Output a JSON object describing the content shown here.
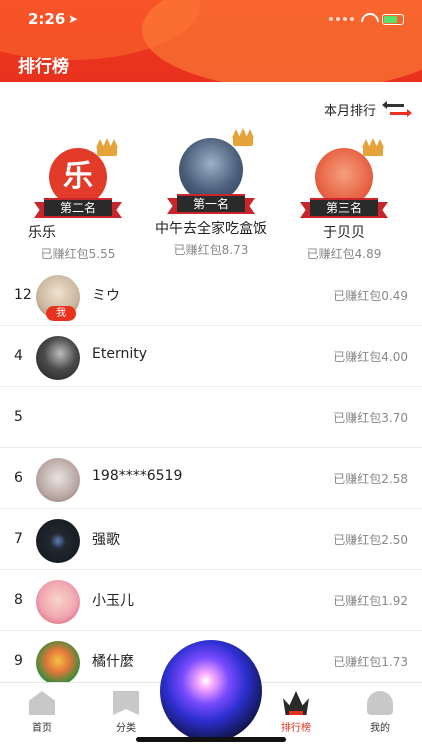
{
  "status": {
    "time": "2:26",
    "location_icon": "location-arrow-icon"
  },
  "header": {
    "title": "排行榜"
  },
  "month_switch": {
    "label": "本月排行",
    "icon": "swap-arrows-icon"
  },
  "podium": [
    {
      "rank_label": "第二名",
      "name": "乐乐",
      "earnings": "已赚红包5.55",
      "avatar_text": "乐",
      "avatar_color": "#e23b2a"
    },
    {
      "rank_label": "第一名",
      "name": "中午去全家吃盒饭",
      "earnings": "已赚红包8.73",
      "avatar_color": "#4b5e7a"
    },
    {
      "rank_label": "第三名",
      "name": "于贝贝",
      "earnings": "已赚红包4.89",
      "avatar_color": "#e45a3c"
    }
  ],
  "list": [
    {
      "rank": "12",
      "name": "ミウ",
      "earnings": "已赚红包0.49",
      "is_me": true,
      "me_label": "我",
      "avatar_color": "#c9b59b"
    },
    {
      "rank": "4",
      "name": "Eternity",
      "earnings": "已赚红包4.00",
      "avatar_color": "#3a3a3a"
    },
    {
      "rank": "5",
      "name": "",
      "earnings": "已赚红包3.70"
    },
    {
      "rank": "6",
      "name": "198****6519",
      "earnings": "已赚红包2.58",
      "avatar_color": "#b9a7a3"
    },
    {
      "rank": "7",
      "name": "强歌",
      "earnings": "已赚红包2.50",
      "avatar_color": "#222831"
    },
    {
      "rank": "8",
      "name": "小玉儿",
      "earnings": "已赚红包1.92",
      "avatar_color": "#f0a6b2"
    },
    {
      "rank": "9",
      "name": "橘什麼",
      "earnings": "已赚红包1.73",
      "avatar_color": "#3b8c3a"
    }
  ],
  "tabs": [
    {
      "label": "首页",
      "icon": "home-icon"
    },
    {
      "label": "分类",
      "icon": "category-icon"
    },
    {
      "label": "排行榜",
      "icon": "crown-icon",
      "active": true
    },
    {
      "label": "我的",
      "icon": "profile-icon"
    }
  ],
  "colors": {
    "brand_red": "#e8321d",
    "muted_text": "#888888"
  }
}
